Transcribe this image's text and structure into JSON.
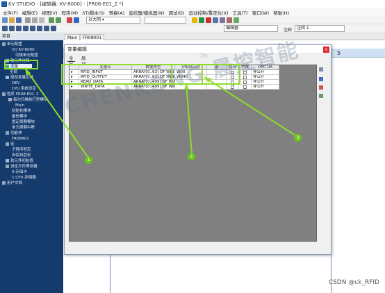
{
  "window": {
    "title": "KV STUDIO - [编辑器: KV-8000] - [FR08-E01_2 *]"
  },
  "menu": [
    "文件(F)",
    "编辑(E)",
    "视图(V)",
    "程序(M)",
    "ST/脚本(S)",
    "转换(A)",
    "监控器/模拟器(N)",
    "调试(D)",
    "运动控制/重定位(X)",
    "工具(T)",
    "窗口(W)",
    "帮助(H)"
  ],
  "toolbar": {
    "combo1": "以大网",
    "combo2": "",
    "combo3": "编辑器",
    "combo4_label": "注释",
    "combo4": "注释 1"
  },
  "project": {
    "header": "项目",
    "items": [
      "单元配置",
      "[0] KV-8000",
      "切换单元配置",
      "软元件注释",
      "变量",
      "全局",
      "局部变量区域",
      "DEV",
      "CPU 系统设定",
      "程序 FR08-E01_2",
      "每次扫描执行型模块",
      "Main",
      "初始化模块",
      "备份模块",
      "固定周期模块",
      "单元周期中断",
      "功能块",
      "FR08R01",
      "宏",
      "子程序型宏",
      "自保持型宏",
      "软元件初始值",
      "设定文件寄存器",
      "0:存储卡",
      "1:CPU 存储器",
      "用户文档"
    ]
  },
  "editor": {
    "tabs": [
      "Main",
      "FR08R01"
    ],
    "col_header": "5"
  },
  "dialog": {
    "title": "变量编辑",
    "close": "×",
    "tabs": [
      "全局",
      "局部"
    ],
    "columns": [
      "",
      "变量名",
      "数据类型",
      "分配软元件",
      "值",
      "保持",
      "常数",
      "OPC UA"
    ],
    "rows": [
      {
        "name": "RFID_INPUT",
        "type": "ARRAY[0..63] OF WINT",
        "device": "W00",
        "opc": "非公开"
      },
      {
        "name": "RFID_OUTPUT",
        "type": "ARRAY[0..63] OF WINT",
        "device": "W040",
        "opc": "非公开"
      },
      {
        "name": "READ_DATA",
        "type": "ARRAY[0..499] OF WINT",
        "device": "",
        "opc": "非公开"
      },
      {
        "name": "WRITE_DATA",
        "type": "ARRAY[0..499] OF WINT",
        "device": "",
        "opc": "非公开"
      }
    ]
  },
  "annotations": {
    "badges": [
      "1",
      "2",
      "3"
    ]
  },
  "watermark": {
    "text": "晨控智能",
    "brand": "CHENKONG",
    "mark": "TM"
  },
  "footer": {
    "credit": "CSDN @ck_RFID"
  },
  "colors": {
    "highlight": "#8fdc2a",
    "project_bg": "#153a6c",
    "grid_bg": "#808080"
  }
}
